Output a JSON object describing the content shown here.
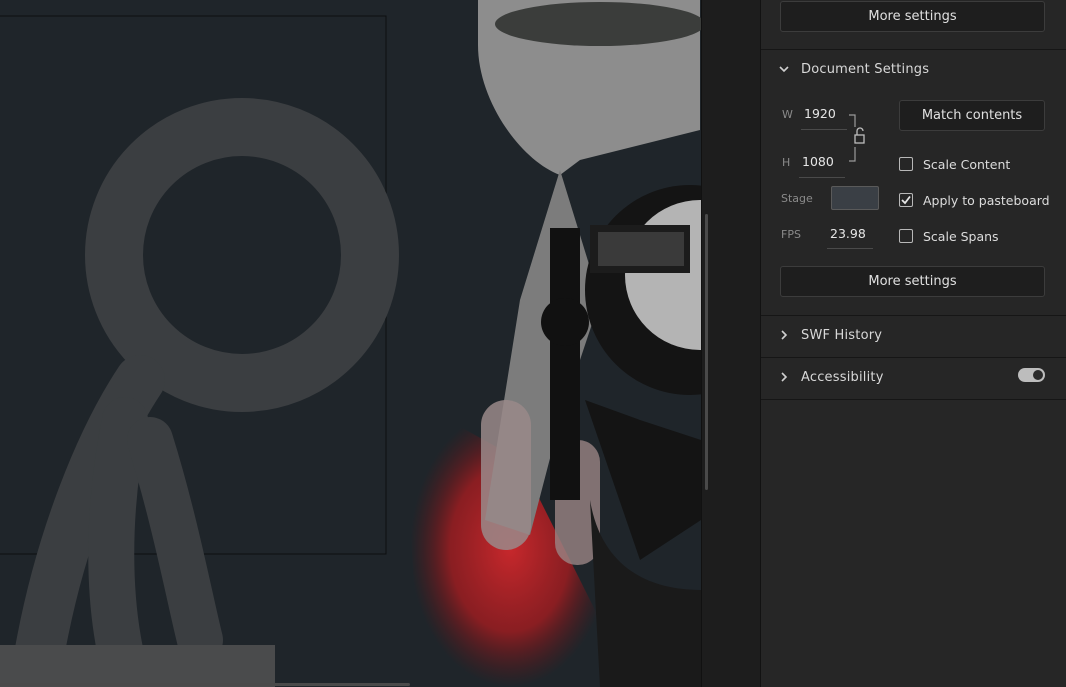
{
  "panel": {
    "top_more_settings": "More settings",
    "document_settings": {
      "title": "Document Settings",
      "width_label": "W",
      "width_value": "1920",
      "height_label": "H",
      "height_value": "1080",
      "match_contents": "Match contents",
      "scale_content": {
        "label": "Scale Content",
        "checked": false
      },
      "apply_to_pasteboard": {
        "label": "Apply to pasteboard",
        "checked": true
      },
      "scale_spans": {
        "label": "Scale Spans",
        "checked": false
      },
      "stage_label": "Stage",
      "stage_color": "#3a3f45",
      "fps_label": "FPS",
      "fps_value": "23.98",
      "more_settings": "More settings"
    },
    "swf_history": {
      "title": "SWF History"
    },
    "accessibility": {
      "title": "Accessibility",
      "toggle_on": true
    }
  },
  "colors": {
    "stage_bg": "#1f252a",
    "panel_bg": "#262626",
    "figure_gray": "#3d3d3d",
    "accent_red": "#c0262c"
  }
}
